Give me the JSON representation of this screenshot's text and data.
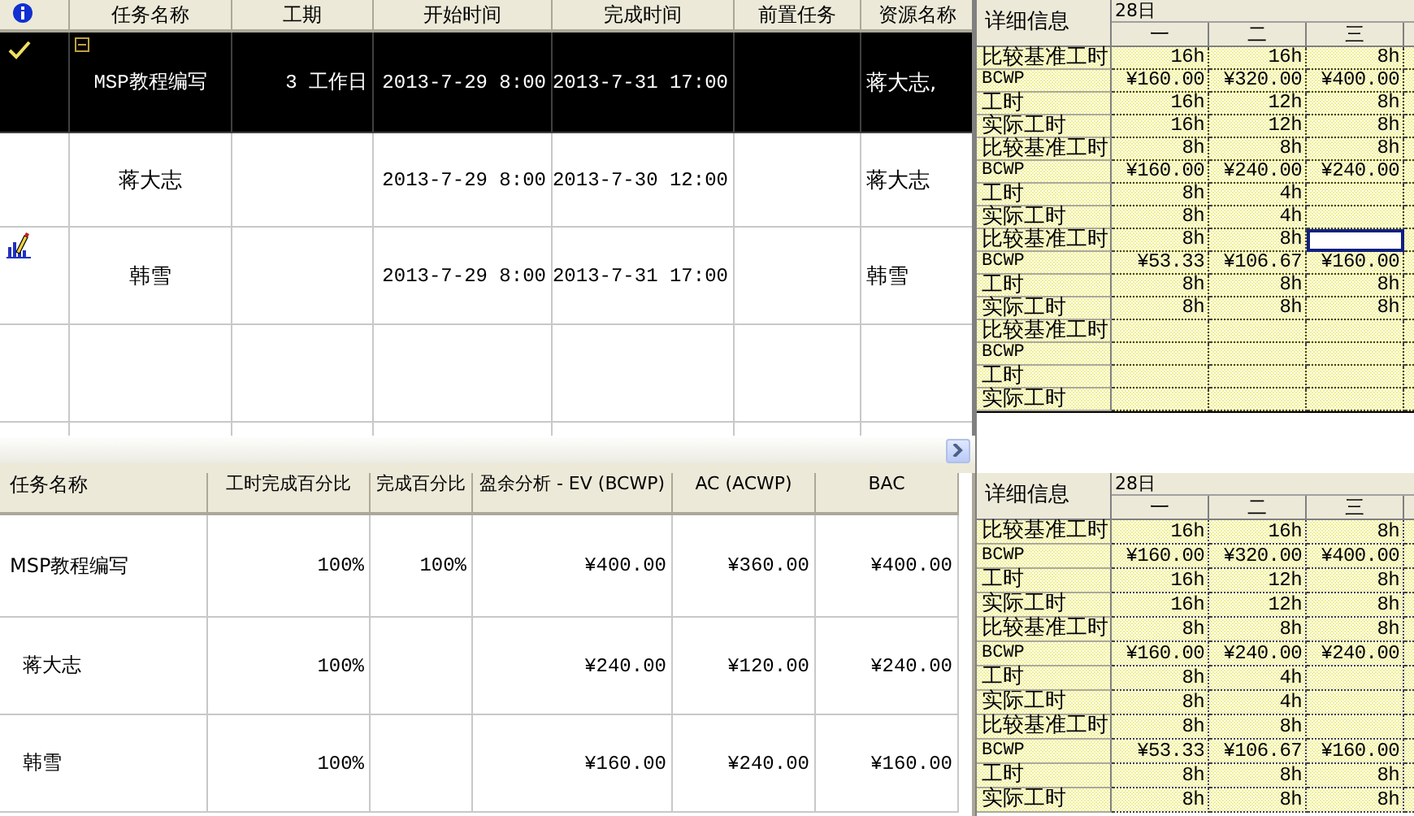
{
  "task_table": {
    "columns": [
      "任务名称",
      "工期",
      "开始时间",
      "完成时间",
      "前置任务",
      "资源名称"
    ],
    "rows": [
      {
        "kind": "task",
        "indicator": {
          "kind": "check"
        },
        "selected": true,
        "expanded": true,
        "name": "MSP教程编写",
        "duration": "3 工作日",
        "start": "2013-7-29 8:00",
        "finish": "2013-7-31 17:00",
        "predecessors": "",
        "resources": "蒋大志,"
      },
      {
        "kind": "assignment",
        "selected": false,
        "name": "蒋大志",
        "duration": "",
        "start": "2013-7-29 8:00",
        "finish": "2013-7-30 12:00",
        "predecessors": "",
        "resources": "蒋大志"
      },
      {
        "kind": "assignment",
        "indicator": {
          "kind": "chart"
        },
        "selected": false,
        "name": "韩雪",
        "duration": "",
        "start": "2013-7-29 8:00",
        "finish": "2013-7-31 17:00",
        "predecessors": "",
        "resources": "韩雪"
      }
    ]
  },
  "top_usage": {
    "header": "详细信息",
    "date": "28日",
    "days": [
      "一",
      "二",
      "三"
    ],
    "rows": [
      {
        "label": "比较基准工时",
        "cells": [
          {
            "text": "16h",
            "selected": false
          },
          {
            "text": "16h",
            "selected": false
          },
          {
            "text": "8h",
            "selected": false
          }
        ]
      },
      {
        "label": "BCWP",
        "cells": [
          {
            "text": "¥160.00",
            "selected": false
          },
          {
            "text": "¥320.00",
            "selected": false
          },
          {
            "text": "¥400.00",
            "selected": false
          }
        ]
      },
      {
        "label": "工时",
        "cells": [
          {
            "text": "16h",
            "selected": false
          },
          {
            "text": "12h",
            "selected": false
          },
          {
            "text": "8h",
            "selected": false
          }
        ]
      },
      {
        "label": "实际工时",
        "cells": [
          {
            "text": "16h",
            "selected": false
          },
          {
            "text": "12h",
            "selected": false
          },
          {
            "text": "8h",
            "selected": false
          }
        ]
      },
      {
        "label": "比较基准工时",
        "cells": [
          {
            "text": "8h",
            "selected": false
          },
          {
            "text": "8h",
            "selected": false
          },
          {
            "text": "8h",
            "selected": false
          }
        ]
      },
      {
        "label": "BCWP",
        "cells": [
          {
            "text": "¥160.00",
            "selected": false
          },
          {
            "text": "¥240.00",
            "selected": false
          },
          {
            "text": "¥240.00",
            "selected": false
          }
        ]
      },
      {
        "label": "工时",
        "cells": [
          {
            "text": "8h",
            "selected": false
          },
          {
            "text": "4h",
            "selected": false
          },
          {
            "text": "",
            "selected": false
          }
        ]
      },
      {
        "label": "实际工时",
        "cells": [
          {
            "text": "8h",
            "selected": false
          },
          {
            "text": "4h",
            "selected": false
          },
          {
            "text": "",
            "selected": false
          }
        ]
      },
      {
        "label": "比较基准工时",
        "cells": [
          {
            "text": "8h",
            "selected": false
          },
          {
            "text": "8h",
            "selected": false
          },
          {
            "text": "",
            "selected": true
          }
        ]
      },
      {
        "label": "BCWP",
        "cells": [
          {
            "text": "¥53.33",
            "selected": false
          },
          {
            "text": "¥106.67",
            "selected": false
          },
          {
            "text": "¥160.00",
            "selected": false
          }
        ]
      },
      {
        "label": "工时",
        "cells": [
          {
            "text": "8h",
            "selected": false
          },
          {
            "text": "8h",
            "selected": false
          },
          {
            "text": "8h",
            "selected": false
          }
        ]
      },
      {
        "label": "实际工时",
        "cells": [
          {
            "text": "8h",
            "selected": false
          },
          {
            "text": "8h",
            "selected": false
          },
          {
            "text": "8h",
            "selected": false
          }
        ]
      },
      {
        "label": "比较基准工时",
        "cells": []
      },
      {
        "label": "BCWP",
        "cells": []
      },
      {
        "label": "工时",
        "cells": []
      },
      {
        "label": "实际工时",
        "cells": []
      }
    ]
  },
  "earned_value_table": {
    "columns": [
      "任务名称",
      "工时完成百分比",
      "完成百分比",
      "盈余分析 - EV (BCWP)",
      "AC (ACWP)",
      "BAC"
    ],
    "rows": [
      {
        "kind": "task",
        "name": "MSP教程编写",
        "work_complete": "100%",
        "percent_complete": "100%",
        "ev": "¥400.00",
        "ac": "¥360.00",
        "bac": "¥400.00"
      },
      {
        "kind": "assignment",
        "name": "蒋大志",
        "work_complete": "100%",
        "percent_complete": "",
        "ev": "¥240.00",
        "ac": "¥120.00",
        "bac": "¥240.00"
      },
      {
        "kind": "assignment",
        "name": "韩雪",
        "work_complete": "100%",
        "percent_complete": "",
        "ev": "¥160.00",
        "ac": "¥240.00",
        "bac": "¥160.00"
      }
    ]
  },
  "bottom_usage": {
    "header": "详细信息",
    "date": "28日",
    "days": [
      "一",
      "二",
      "三"
    ],
    "rows": [
      {
        "label": "比较基准工时",
        "cells": [
          {
            "text": "16h",
            "selected": false
          },
          {
            "text": "16h",
            "selected": false
          },
          {
            "text": "8h",
            "selected": false
          }
        ]
      },
      {
        "label": "BCWP",
        "cells": [
          {
            "text": "¥160.00",
            "selected": false
          },
          {
            "text": "¥320.00",
            "selected": false
          },
          {
            "text": "¥400.00",
            "selected": false
          }
        ]
      },
      {
        "label": "工时",
        "cells": [
          {
            "text": "16h",
            "selected": false
          },
          {
            "text": "12h",
            "selected": false
          },
          {
            "text": "8h",
            "selected": false
          }
        ]
      },
      {
        "label": "实际工时",
        "cells": [
          {
            "text": "16h",
            "selected": false
          },
          {
            "text": "12h",
            "selected": false
          },
          {
            "text": "8h",
            "selected": false
          }
        ]
      },
      {
        "label": "比较基准工时",
        "cells": [
          {
            "text": "8h",
            "selected": false
          },
          {
            "text": "8h",
            "selected": false
          },
          {
            "text": "8h",
            "selected": false
          }
        ]
      },
      {
        "label": "BCWP",
        "cells": [
          {
            "text": "¥160.00",
            "selected": false
          },
          {
            "text": "¥240.00",
            "selected": false
          },
          {
            "text": "¥240.00",
            "selected": false
          }
        ]
      },
      {
        "label": "工时",
        "cells": [
          {
            "text": "8h",
            "selected": false
          },
          {
            "text": "4h",
            "selected": false
          },
          {
            "text": "",
            "selected": false
          }
        ]
      },
      {
        "label": "实际工时",
        "cells": [
          {
            "text": "8h",
            "selected": false
          },
          {
            "text": "4h",
            "selected": false
          },
          {
            "text": "",
            "selected": false
          }
        ]
      },
      {
        "label": "比较基准工时",
        "cells": [
          {
            "text": "8h",
            "selected": false
          },
          {
            "text": "8h",
            "selected": false
          },
          {
            "text": "",
            "selected": false
          }
        ]
      },
      {
        "label": "BCWP",
        "cells": [
          {
            "text": "¥53.33",
            "selected": false
          },
          {
            "text": "¥106.67",
            "selected": false
          },
          {
            "text": "¥160.00",
            "selected": false
          }
        ]
      },
      {
        "label": "工时",
        "cells": [
          {
            "text": "8h",
            "selected": false
          },
          {
            "text": "8h",
            "selected": false
          },
          {
            "text": "8h",
            "selected": false
          }
        ]
      },
      {
        "label": "实际工时",
        "cells": [
          {
            "text": "8h",
            "selected": false
          },
          {
            "text": "8h",
            "selected": false
          },
          {
            "text": "8h",
            "selected": false
          }
        ]
      }
    ]
  }
}
